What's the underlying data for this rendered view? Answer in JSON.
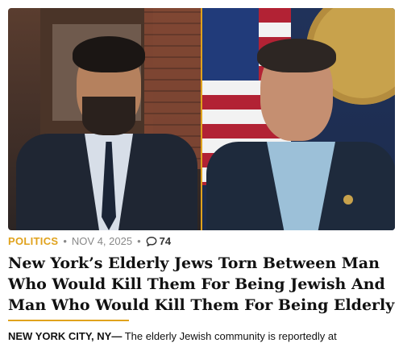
{
  "article": {
    "section": "POLITICS",
    "date": "NOV 4, 2025",
    "comment_count": "74",
    "headline": "New York’s Elderly Jews Torn Between Man Who Would Kill Them For Being Jewish And Man Who Would Kill Them For Being Elderly",
    "dateline": "NEW YORK CITY, NY—",
    "lede_visible": "The elderly Jewish community is reportedly at"
  },
  "colors": {
    "accent": "#e0a21c",
    "meta_gray": "#888888",
    "headline": "#111111"
  },
  "icons": {
    "comment": "speech-bubble-outline"
  }
}
